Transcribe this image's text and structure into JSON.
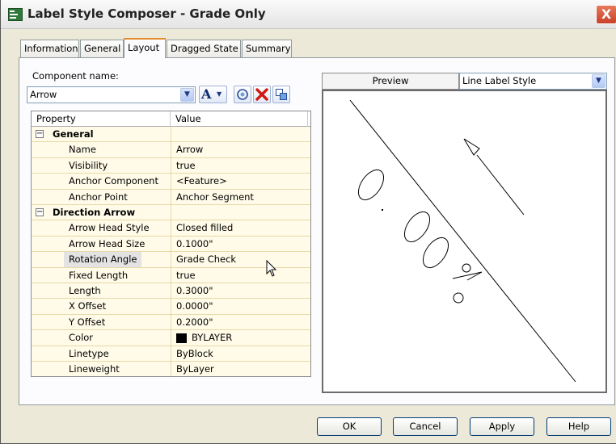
{
  "window": {
    "title": "Label Style Composer - Grade Only",
    "close_glyph": "X"
  },
  "tabs": [
    {
      "label": "Information"
    },
    {
      "label": "General"
    },
    {
      "label": "Layout",
      "active": true
    },
    {
      "label": "Dragged State"
    },
    {
      "label": "Summary"
    }
  ],
  "component": {
    "label": "Component name:",
    "value": "Arrow"
  },
  "toolbar": {
    "text_icon": "A",
    "icons": [
      "text-component-icon",
      "copy-component-icon",
      "delete-component-icon",
      "draw-order-icon"
    ]
  },
  "grid": {
    "headers": [
      "Property",
      "Value"
    ],
    "rows": [
      {
        "type": "group",
        "toggle": "−",
        "property": "General",
        "value": ""
      },
      {
        "property": "Name",
        "value": "Arrow"
      },
      {
        "property": "Visibility",
        "value": "true"
      },
      {
        "property": "Anchor Component",
        "value": "<Feature>"
      },
      {
        "property": "Anchor Point",
        "value": "Anchor Segment"
      },
      {
        "type": "group",
        "toggle": "−",
        "property": "Direction Arrow",
        "value": ""
      },
      {
        "property": "Arrow Head Style",
        "value": "Closed filled"
      },
      {
        "property": "Arrow Head Size",
        "value": "0.1000\""
      },
      {
        "property": "Rotation Angle",
        "value": "Grade Check",
        "selected": true
      },
      {
        "property": "Fixed Length",
        "value": "true"
      },
      {
        "property": "Length",
        "value": "0.3000\""
      },
      {
        "property": "X Offset",
        "value": "0.0000\""
      },
      {
        "property": "Y Offset",
        "value": "0.2000\""
      },
      {
        "property": "Color",
        "value": "BYLAYER",
        "swatch": "#000000"
      },
      {
        "property": "Linetype",
        "value": "ByBlock"
      },
      {
        "property": "Lineweight",
        "value": "ByLayer"
      }
    ]
  },
  "preview": {
    "label": "Preview",
    "style_value": "Line Label Style"
  },
  "buttons": {
    "ok": "OK",
    "cancel": "Cancel",
    "apply": "Apply",
    "help": "Help"
  },
  "colors": {
    "titlebar": "#e8e8e8",
    "dialog_bg": "#ece9d8",
    "grid_bg": "#fffbe8",
    "active_tab_accent": "#e68b2c",
    "close_red": "#d0492f"
  }
}
